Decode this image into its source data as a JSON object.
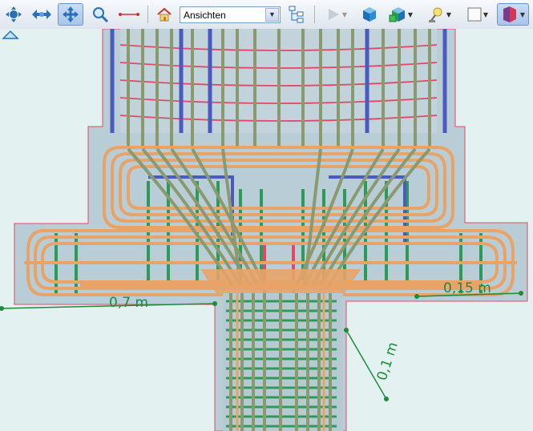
{
  "toolbar": {
    "tools": [
      {
        "name": "navigate-tool-icon"
      },
      {
        "name": "pan-tool-icon"
      },
      {
        "name": "move-tool-icon",
        "active": true
      },
      {
        "name": "zoom-tool-icon"
      },
      {
        "name": "measure-tool-icon"
      },
      {
        "name": "home-icon"
      },
      {
        "name": "views-tree-icon"
      },
      {
        "name": "play-icon"
      },
      {
        "name": "cube-shaded-icon"
      },
      {
        "name": "cube-colored-icon"
      },
      {
        "name": "light-icon"
      },
      {
        "name": "background-color-icon"
      },
      {
        "name": "section-plane-icon"
      }
    ],
    "views_select": {
      "value": "Ansichten"
    }
  },
  "viewport": {
    "dimensions": [
      {
        "label": "0,7 m"
      },
      {
        "label": "0,15 m"
      },
      {
        "label": "0,1 m"
      }
    ],
    "colors": {
      "background": "#e4f1f1",
      "concrete": "#b8cdd6",
      "rebar_orange": "#e8a468",
      "rebar_grey": "#8a9a70",
      "rebar_green": "#2e9a5a",
      "rebar_blue": "#4a5abf",
      "rebar_red": "#e04a66",
      "dimension": "#1f8a3a"
    }
  }
}
